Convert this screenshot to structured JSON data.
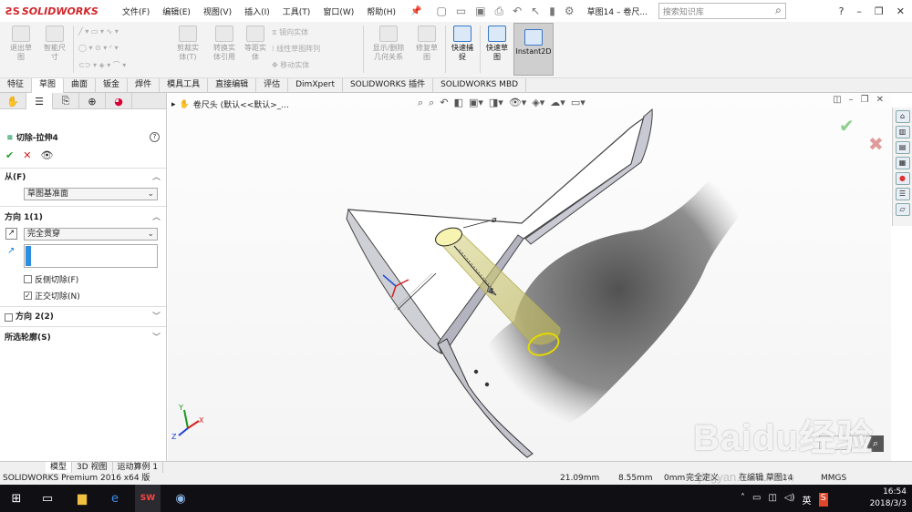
{
  "app": {
    "logo": "SOLIDWORKS",
    "menu": [
      "文件(F)",
      "编辑(E)",
      "视图(V)",
      "插入(I)",
      "工具(T)",
      "窗口(W)",
      "帮助(H)"
    ],
    "doc_title": "草图14 – 卷尺...",
    "search_placeholder": "搜索知识库"
  },
  "commands": [
    {
      "label": "退出草\n图",
      "enabled": false
    },
    {
      "label": "智能尺\n寸",
      "enabled": false
    },
    {
      "label": "剪裁实\n体(T)",
      "enabled": false
    },
    {
      "label": "转换实\n体引用",
      "enabled": false
    },
    {
      "label": "等距实\n体",
      "enabled": false
    },
    {
      "label": "显示/删除\n几何关系",
      "enabled": false
    },
    {
      "label": "修复草\n图",
      "enabled": false
    },
    {
      "label": "快速捕\n捉",
      "enabled": true
    },
    {
      "label": "快速草\n图",
      "enabled": true
    },
    {
      "label": "Instant2D",
      "enabled": true
    }
  ],
  "mini_commands": [
    "镜向实体",
    "线性草图阵列",
    "移动实体"
  ],
  "tabs": [
    {
      "label": "特征",
      "active": false
    },
    {
      "label": "草图",
      "active": true
    },
    {
      "label": "曲面",
      "active": false
    },
    {
      "label": "钣金",
      "active": false
    },
    {
      "label": "焊件",
      "active": false
    },
    {
      "label": "模具工具",
      "active": false
    },
    {
      "label": "直接编辑",
      "active": false
    },
    {
      "label": "评估",
      "active": false
    },
    {
      "label": "DimXpert",
      "active": false
    },
    {
      "label": "SOLIDWORKS 插件",
      "active": false
    },
    {
      "label": "SOLIDWORKS MBD",
      "active": false
    }
  ],
  "property_manager": {
    "title": "切除-拉伸4",
    "from_label": "从(F)",
    "from_value": "草图基准面",
    "direction1_label": "方向 1(1)",
    "direction1_value": "完全贯穿",
    "flip_side_label": "反侧切除(F)",
    "flip_side_checked": false,
    "normal_cut_label": "正交切除(N)",
    "normal_cut_checked": true,
    "direction2_label": "方向 2(2)",
    "contours_label": "所选轮廓(S)"
  },
  "viewport": {
    "crumb": "卷尺头 (默认<<默认>_...",
    "triad": {
      "x": "X",
      "y": "Y",
      "z": "Z"
    },
    "dim_label": "ø"
  },
  "bottom_tabs": [
    {
      "label": "模型",
      "active": true
    },
    {
      "label": "3D 视图",
      "active": false
    },
    {
      "label": "运动算例 1",
      "active": false
    }
  ],
  "status": {
    "product": "SOLIDWORKS Premium 2016 x64 版",
    "x": "21.09mm",
    "y": "8.55mm",
    "z": "0mm",
    "state": "完全定义",
    "editing": "在编辑 草图14",
    "units": "MMGS"
  },
  "taskbar": {
    "time": "16:54",
    "date": "2018/3/3",
    "ime": "英"
  },
  "watermark": {
    "main": "Baidu经验",
    "url": "jingyan.baidu.com"
  },
  "colors": {
    "accent": "#3a79c7",
    "logo_red": "#d0252b",
    "ok_green": "#2e9d2e",
    "cancel_red": "#d02020",
    "yellow_cut": "#e8e060"
  }
}
